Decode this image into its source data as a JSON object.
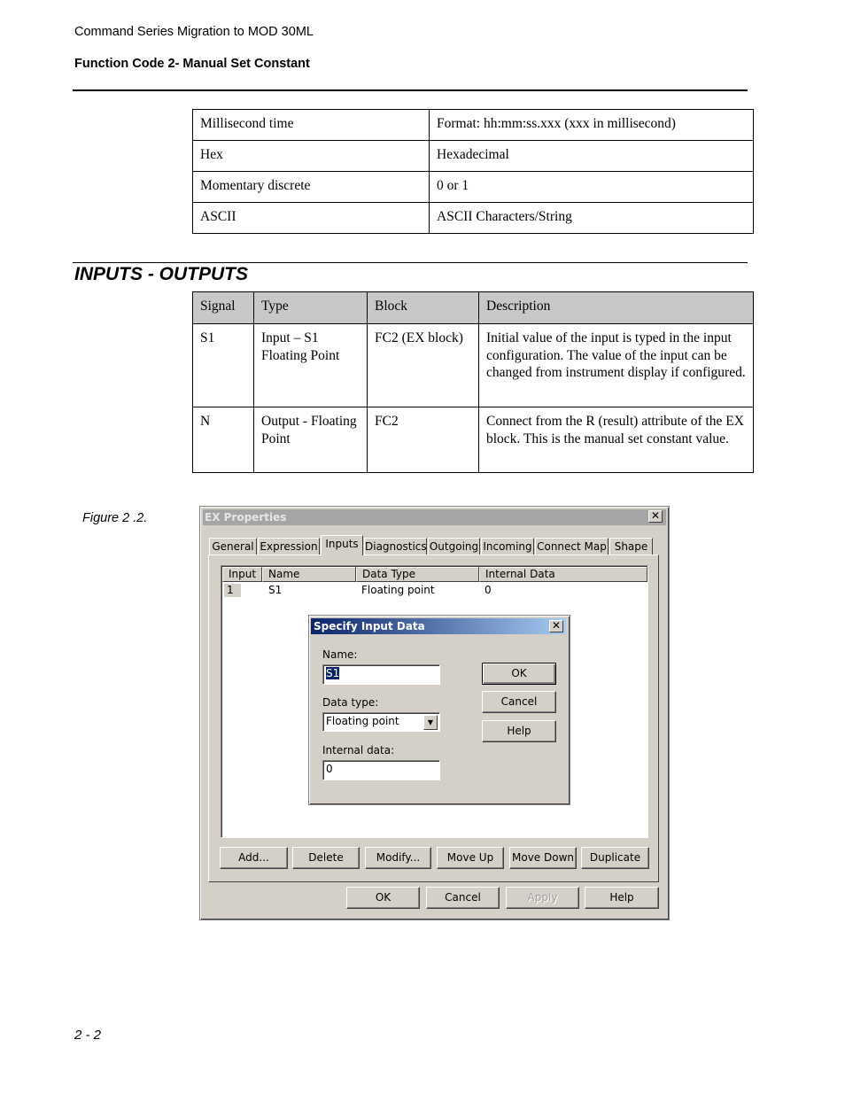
{
  "header": {
    "doc_title": "Command Series Migration to MOD 30ML",
    "section_title": "Function Code 2- Manual Set Constant"
  },
  "types_table": {
    "rows": [
      [
        "Millisecond time",
        "Format: hh:mm:ss.xxx (xxx in millisecond)"
      ],
      [
        "Hex",
        "Hexadecimal"
      ],
      [
        "Momentary discrete",
        "0 or 1"
      ],
      [
        "ASCII",
        "ASCII Characters/String"
      ]
    ]
  },
  "io_section": {
    "title": "INPUTS - OUTPUTS",
    "columns": [
      "Signal",
      "Type",
      "Block",
      "Description"
    ],
    "rows": [
      [
        "S1",
        "Input – S1 Floating Point",
        "FC2 (EX block)",
        "Initial value of the input is typed in the input configuration. The value of the input can be changed from instrument display if configured."
      ],
      [
        "N",
        "Output - Floating Point",
        "FC2",
        "Connect from the R (result) attribute of the EX block. This is the manual set constant value."
      ]
    ]
  },
  "figure": {
    "caption": "Figure 2 .2.",
    "window": {
      "title": "EX Properties",
      "close_glyph": "✕",
      "tabs": [
        "General",
        "Expression",
        "Inputs",
        "Diagnostics",
        "Outgoing",
        "Incoming",
        "Connect Map",
        "Shape"
      ],
      "active_tab": "Inputs",
      "list": {
        "columns": [
          "Input",
          "Name",
          "Data Type",
          "Internal Data"
        ],
        "rows": [
          [
            "1",
            "S1",
            "Floating point",
            "0"
          ]
        ]
      },
      "list_buttons": [
        "Add...",
        "Delete",
        "Modify...",
        "Move Up",
        "Move Down",
        "Duplicate"
      ],
      "footer_buttons": [
        "OK",
        "Cancel",
        "Apply",
        "Help"
      ],
      "disabled_buttons": [
        "Apply"
      ]
    },
    "dialog": {
      "title": "Specify Input Data",
      "close_glyph": "✕",
      "name_label": "Name:",
      "name_value": "S1",
      "data_type_label": "Data type:",
      "data_type_value": "Floating point",
      "dropdown_glyph": "▼",
      "internal_data_label": "Internal data:",
      "internal_data_value": "0",
      "ok_label": "OK",
      "cancel_label": "Cancel",
      "help_label": "Help"
    }
  },
  "footer": {
    "page_number": "2 - 2"
  }
}
